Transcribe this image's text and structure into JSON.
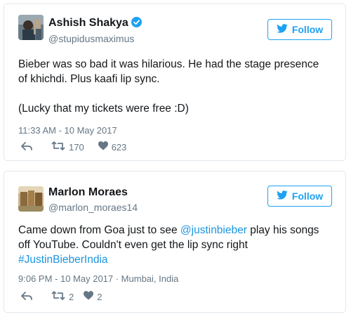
{
  "tweets": [
    {
      "name": "Ashish Shakya",
      "verified": true,
      "handle": "@stupidusmaximus",
      "follow_label": "Follow",
      "text_lines": [
        "Bieber was so bad it was hilarious. He had the stage presence",
        "of khichdi. Plus kaafi lip sync.",
        "",
        "(Lucky that my tickets were free :D)"
      ],
      "timestamp": "11:33 AM - 10 May 2017",
      "location": "",
      "retweets": "170",
      "likes": "623"
    },
    {
      "name": "Marlon Moraes",
      "verified": false,
      "handle": "@marlon_moraes14",
      "follow_label": "Follow",
      "text_line1_prefix": "Came down from Goa just to see ",
      "mention": "@justinbieber",
      "text_line1_suffix": " play his songs",
      "text_line2": "off YouTube. Couldn't even get the lip sync right",
      "hashtag": "#JustinBieberIndia",
      "timestamp": "9:06 PM - 10 May 2017 · Mumbai, India",
      "retweets": "2",
      "likes": "2"
    }
  ],
  "icons": {
    "verified": "verified-badge-icon",
    "twitter_bird": "twitter-bird-icon",
    "reply": "reply-icon",
    "retweet": "retweet-icon",
    "like": "heart-icon"
  },
  "colors": {
    "accent": "#1da1f2",
    "link": "#1b95e0",
    "secondary_text": "#657786",
    "border": "#e1e8ed"
  }
}
